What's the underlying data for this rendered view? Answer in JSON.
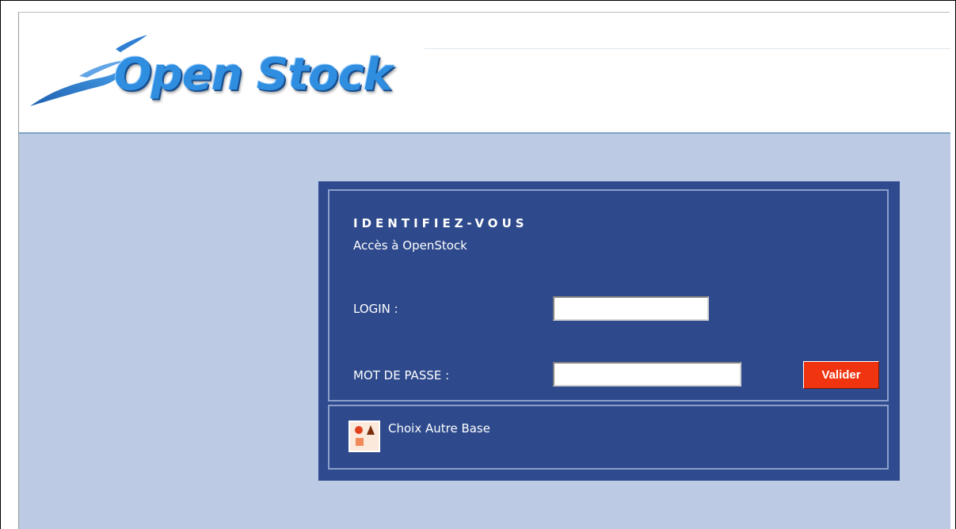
{
  "header": {
    "logo_text": "Open Stock",
    "colors": {
      "logo_blue": "#2f8ee0",
      "background": "#bccbe3",
      "panel": "#2f4a8e",
      "button": "#f0340f"
    }
  },
  "login": {
    "title": "IDENTIFIEZ-VOUS",
    "subtitle": "Accès à OpenStock",
    "login_label": "LOGIN :",
    "login_value": "",
    "password_label": "MOT DE PASSE :",
    "password_value": "",
    "submit_label": "Valider"
  },
  "database": {
    "icon": "database-shapes-icon",
    "link_label": "Choix Autre Base"
  }
}
